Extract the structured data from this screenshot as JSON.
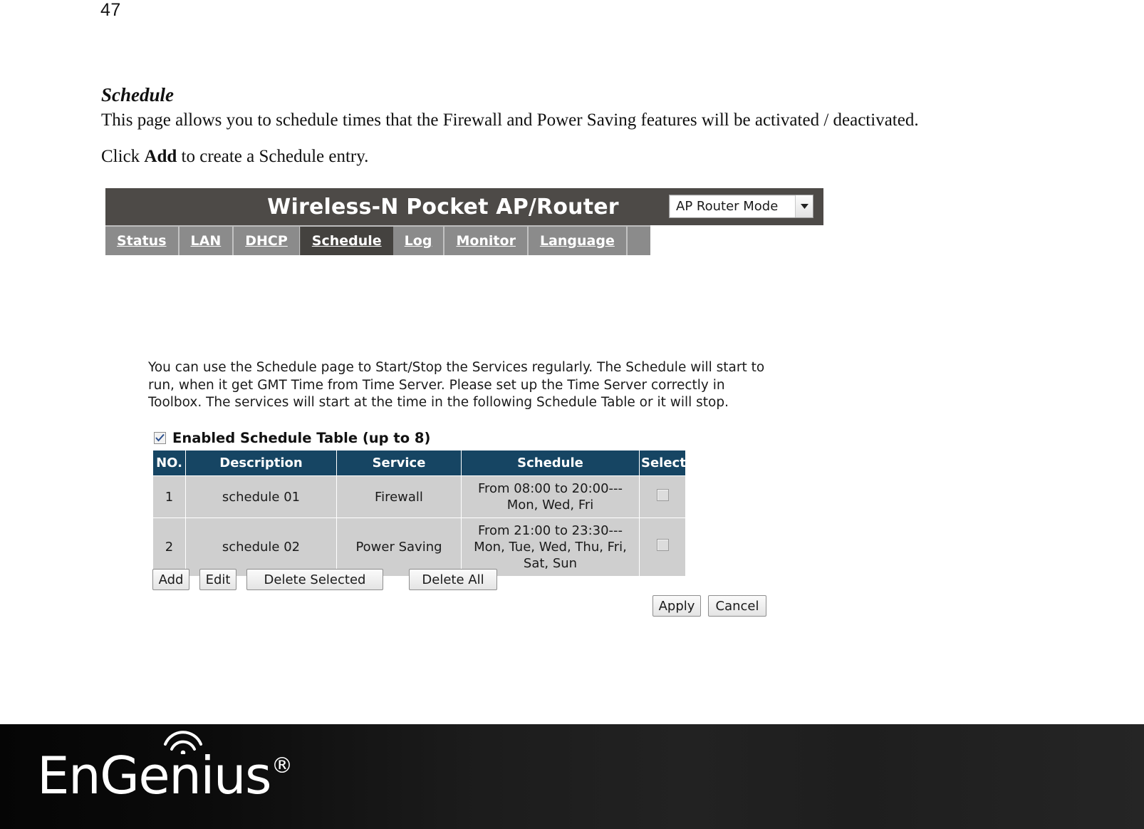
{
  "document": {
    "page_number": "47",
    "heading": "Schedule",
    "paragraph_1": "This page allows you to schedule times that the Firewall and Power Saving features will be activated / deactivated.",
    "paragraph_2_prefix": "Click ",
    "paragraph_2_bold": "Add",
    "paragraph_2_suffix": " to create a Schedule entry."
  },
  "router_ui": {
    "title": "Wireless-N Pocket AP/Router",
    "mode_select": {
      "value": "AP Router Mode",
      "icon": "chevron-down-icon"
    },
    "nav_tabs": [
      {
        "label": "Status",
        "active": false
      },
      {
        "label": "LAN",
        "active": false
      },
      {
        "label": "DHCP",
        "active": false
      },
      {
        "label": "Schedule",
        "active": true
      },
      {
        "label": "Log",
        "active": false
      },
      {
        "label": "Monitor",
        "active": false
      },
      {
        "label": "Language",
        "active": false
      }
    ],
    "description": "You can use the Schedule page to Start/Stop the Services regularly. The Schedule will start to run, when it get GMT Time from Time Server. Please set up the Time Server correctly in Toolbox. The services will start at the time in the following Schedule Table or it will stop.",
    "enabled_table": {
      "checked": true,
      "label": "Enabled Schedule Table (up to 8)"
    },
    "table": {
      "headers": [
        "NO.",
        "Description",
        "Service",
        "Schedule",
        "Select"
      ],
      "rows": [
        {
          "no": "1",
          "description": "schedule 01",
          "service": "Firewall",
          "schedule": "From 08:00 to 20:00---Mon, Wed, Fri",
          "selected": false
        },
        {
          "no": "2",
          "description": "schedule 02",
          "service": "Power Saving",
          "schedule": "From 21:00 to 23:30---Mon, Tue, Wed, Thu, Fri, Sat, Sun",
          "selected": false
        }
      ]
    },
    "buttons": {
      "add": "Add",
      "edit": "Edit",
      "delete_selected": "Delete Selected",
      "delete_all": "Delete All",
      "apply": "Apply",
      "cancel": "Cancel"
    },
    "colors": {
      "titlebar": "#4d4a47",
      "navbar": "#8b8b8b",
      "nav_active": "#44423f",
      "table_header": "#164563",
      "table_row": "#cfcfcf"
    }
  },
  "footer": {
    "brand": "EnGenius",
    "registered_mark": "®",
    "wifi_icon": "wifi-signal-icon",
    "background": "#1d1d1d"
  }
}
